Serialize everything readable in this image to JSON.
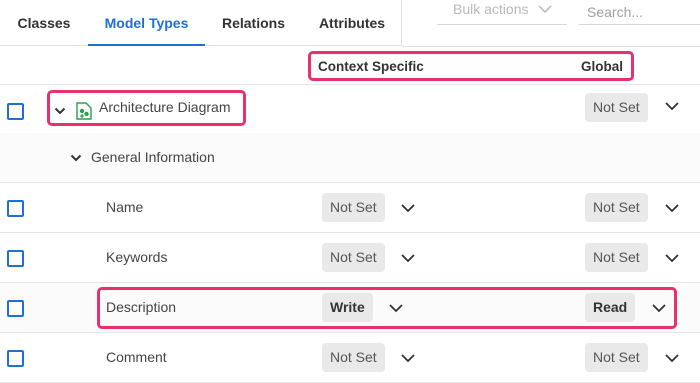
{
  "tabs": [
    {
      "label": "Classes",
      "active": false
    },
    {
      "label": "Model Types",
      "active": true
    },
    {
      "label": "Relations",
      "active": false
    },
    {
      "label": "Attributes",
      "active": false
    }
  ],
  "bulk_actions": {
    "label": "Bulk actions"
  },
  "search": {
    "placeholder": "Search..."
  },
  "columns": {
    "context_specific": "Context Specific",
    "global": "Global"
  },
  "tree": {
    "model_type": {
      "label": "Architecture Diagram",
      "icon": "diagram-icon",
      "global": "Not Set"
    },
    "group": {
      "label": "General Information"
    },
    "attributes": [
      {
        "label": "Name",
        "context": "Not Set",
        "global": "Not Set"
      },
      {
        "label": "Keywords",
        "context": "Not Set",
        "global": "Not Set"
      },
      {
        "label": "Description",
        "context": "Write",
        "global": "Read"
      },
      {
        "label": "Comment",
        "context": "Not Set",
        "global": "Not Set"
      }
    ]
  },
  "colors": {
    "accent": "#1f6fd8",
    "highlight": "#e8306a",
    "icon_green": "#2e9e4f"
  }
}
